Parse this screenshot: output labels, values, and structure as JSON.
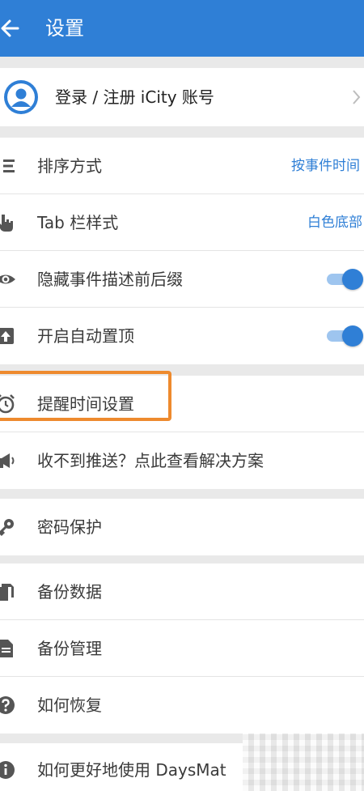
{
  "header": {
    "title": "设置"
  },
  "account": {
    "label": "登录 / 注册 iCity 账号"
  },
  "sections": {
    "display": {
      "sort": {
        "label": "排序方式",
        "value": "按事件时间"
      },
      "tab_style": {
        "label": "Tab 栏样式",
        "value": "白色底部"
      },
      "hide_affix": {
        "label": "隐藏事件描述前后缀",
        "enabled": true
      },
      "auto_pin": {
        "label": "开启自动置顶",
        "enabled": true
      }
    },
    "reminder": {
      "reminder_time": {
        "label": "提醒时间设置"
      },
      "push_help": {
        "label": "收不到推送？点此查看解决方案"
      }
    },
    "security": {
      "password": {
        "label": "密码保护"
      }
    },
    "backup": {
      "backup_data": {
        "label": "备份数据"
      },
      "backup_manage": {
        "label": "备份管理"
      },
      "restore": {
        "label": "如何恢复"
      }
    },
    "help": {
      "how_to_use": {
        "label": "如何更好地使用 DaysMat"
      }
    }
  },
  "colors": {
    "primary": "#2f7fd6",
    "highlight": "#ee8a2e"
  }
}
